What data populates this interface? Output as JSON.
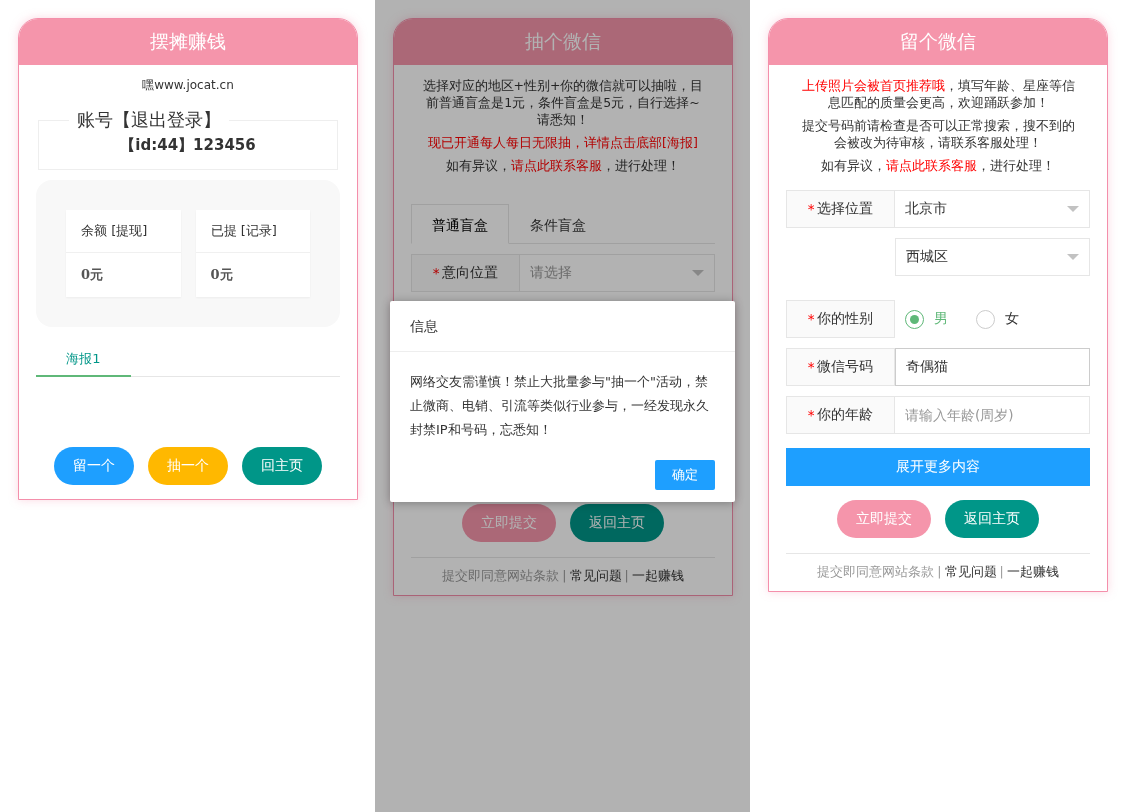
{
  "left_panel": {
    "title": "摆摊赚钱",
    "site": "嘿www.jocat.cn",
    "account": {
      "legend": "账号【退出登录】",
      "id_line": "【id:44】123456"
    },
    "stats": [
      {
        "label": "余额 [提现]",
        "value": "0元"
      },
      {
        "label": "已提 [记录]",
        "value": "0元"
      }
    ],
    "tabs": [
      {
        "label": "海报1",
        "selected": true
      }
    ],
    "buttons": [
      {
        "label": "留一个",
        "kind": "blue"
      },
      {
        "label": "抽一个",
        "kind": "yellow"
      },
      {
        "label": "回主页",
        "kind": "teal"
      }
    ]
  },
  "middle_panel": {
    "title": "抽个微信",
    "notes": [
      {
        "parts": [
          {
            "text": "选择对应的地区+性别+你的微信就可以抽啦，目前普通盲盒是1元，条件盲盒是5元，自行选择~请悉知！",
            "kind": "plain"
          }
        ]
      },
      {
        "parts": [
          {
            "text": "现已开通每人每日无限抽，详情点击底部[海报]",
            "kind": "red"
          }
        ]
      },
      {
        "parts": [
          {
            "text": "如有异议，",
            "kind": "plain"
          },
          {
            "text": "请点此联系客服",
            "kind": "link"
          },
          {
            "text": "，进行处理！",
            "kind": "plain"
          }
        ]
      }
    ],
    "tabs": [
      {
        "label": "普通盲盒",
        "selected": true
      },
      {
        "label": "条件盲盒",
        "selected": false
      }
    ],
    "fields": [
      {
        "mark": "*",
        "label": "意向位置",
        "kind": "select",
        "placeholder": "请选择"
      }
    ],
    "buttons": [
      {
        "label": "立即提交",
        "kind": "pink"
      },
      {
        "label": "返回主页",
        "kind": "teal"
      }
    ],
    "footer": [
      "提交即同意网站条款",
      "|",
      "常见问题",
      "|",
      "一起赚钱"
    ]
  },
  "dialog": {
    "title": "信息",
    "message": "网络交友需谨慎！禁止大批量参与\"抽一个\"活动，禁止微商、电销、引流等类似行业参与，一经发现永久封禁IP和号码，忘悉知！",
    "button": "确定"
  },
  "right_panel": {
    "title": "留个微信",
    "notes": [
      {
        "parts": [
          {
            "text": "上传照片会被首页推荐哦",
            "kind": "red"
          },
          {
            "text": "，填写年龄、星座等信息匹配的质量会更高，欢迎踊跃参加！",
            "kind": "plain"
          }
        ]
      },
      {
        "parts": [
          {
            "text": "提交号码前请检查是否可以正常搜索，搜不到的会被改为待审核，请联系客服处理！",
            "kind": "plain"
          }
        ]
      },
      {
        "parts": [
          {
            "text": "如有异议，",
            "kind": "plain"
          },
          {
            "text": "请点此联系客服",
            "kind": "link"
          },
          {
            "text": "，进行处理！",
            "kind": "plain"
          }
        ]
      }
    ],
    "fields": [
      {
        "mark": "*",
        "label": "选择位置",
        "kind": "select",
        "value": "北京市"
      },
      {
        "kind": "select",
        "value": "西城区"
      },
      {
        "mark": "*",
        "label": "你的性别",
        "kind": "radio",
        "options": [
          {
            "label": "男",
            "selected": true
          },
          {
            "label": "女",
            "selected": false
          }
        ]
      },
      {
        "mark": "*",
        "label": "微信号码",
        "kind": "input",
        "value": "奇偶猫"
      },
      {
        "mark": "*",
        "label": "你的年龄",
        "kind": "input",
        "placeholder": "请输入年龄(周岁)"
      }
    ],
    "expand_button": "展开更多内容",
    "buttons": [
      {
        "label": "立即提交",
        "kind": "pink"
      },
      {
        "label": "返回主页",
        "kind": "teal"
      }
    ],
    "footer": [
      "提交即同意网站条款",
      "|",
      "常见问题",
      "|",
      "一起赚钱"
    ]
  }
}
